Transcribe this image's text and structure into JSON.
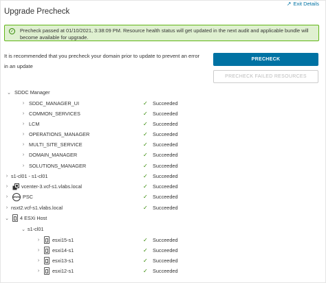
{
  "header": {
    "exit_label": "Exit Details",
    "title": "Upgrade Precheck"
  },
  "alert": {
    "text": "Precheck passed at 01/10/2021, 3:38:09 PM. Resource health status will get updated in the next audit and applicable bundle will become available for upgrade."
  },
  "note": {
    "text": "It is recommended that you precheck your domain prior to update to prevent an error in an update"
  },
  "buttons": {
    "precheck": "PRECHECK",
    "precheck_failed": "PRECHECK FAILED RESOURCES"
  },
  "tree": {
    "sddc_manager": {
      "label": "SDDC Manager",
      "children": [
        {
          "name": "SDDC_MANAGER_UI",
          "status": "Succeeded"
        },
        {
          "name": "COMMON_SERVICES",
          "status": "Succeeded"
        },
        {
          "name": "LCM",
          "status": "Succeeded"
        },
        {
          "name": "OPERATIONS_MANAGER",
          "status": "Succeeded"
        },
        {
          "name": "MULTI_SITE_SERVICE",
          "status": "Succeeded"
        },
        {
          "name": "DOMAIN_MANAGER",
          "status": "Succeeded"
        },
        {
          "name": "SOLUTIONS_MANAGER",
          "status": "Succeeded"
        }
      ]
    },
    "cluster": {
      "name": "s1-cl01 - s1-cl01",
      "status": "Succeeded"
    },
    "vcenter": {
      "name": "vcenter-3.vcf-s1.vlabs.local",
      "status": "Succeeded",
      "icon_text": ""
    },
    "psc": {
      "name": "PSC",
      "status": "Succeeded",
      "icon_text": "WWW"
    },
    "nsxt": {
      "name": "nsxt2.vcf-s1.vlabs.local",
      "status": "Succeeded"
    },
    "esxi": {
      "label": "4 ESXi Host",
      "cluster_label": "s1-cl01",
      "hosts": [
        {
          "name": "esxi15-s1",
          "status": "Succeeded"
        },
        {
          "name": "esxi14-s1",
          "status": "Succeeded"
        },
        {
          "name": "esxi13-s1",
          "status": "Succeeded"
        },
        {
          "name": "esxi12-s1",
          "status": "Succeeded"
        }
      ]
    }
  },
  "colors": {
    "primary": "#0072a3",
    "success": "#318700",
    "alert_bg": "#dff0d0"
  }
}
